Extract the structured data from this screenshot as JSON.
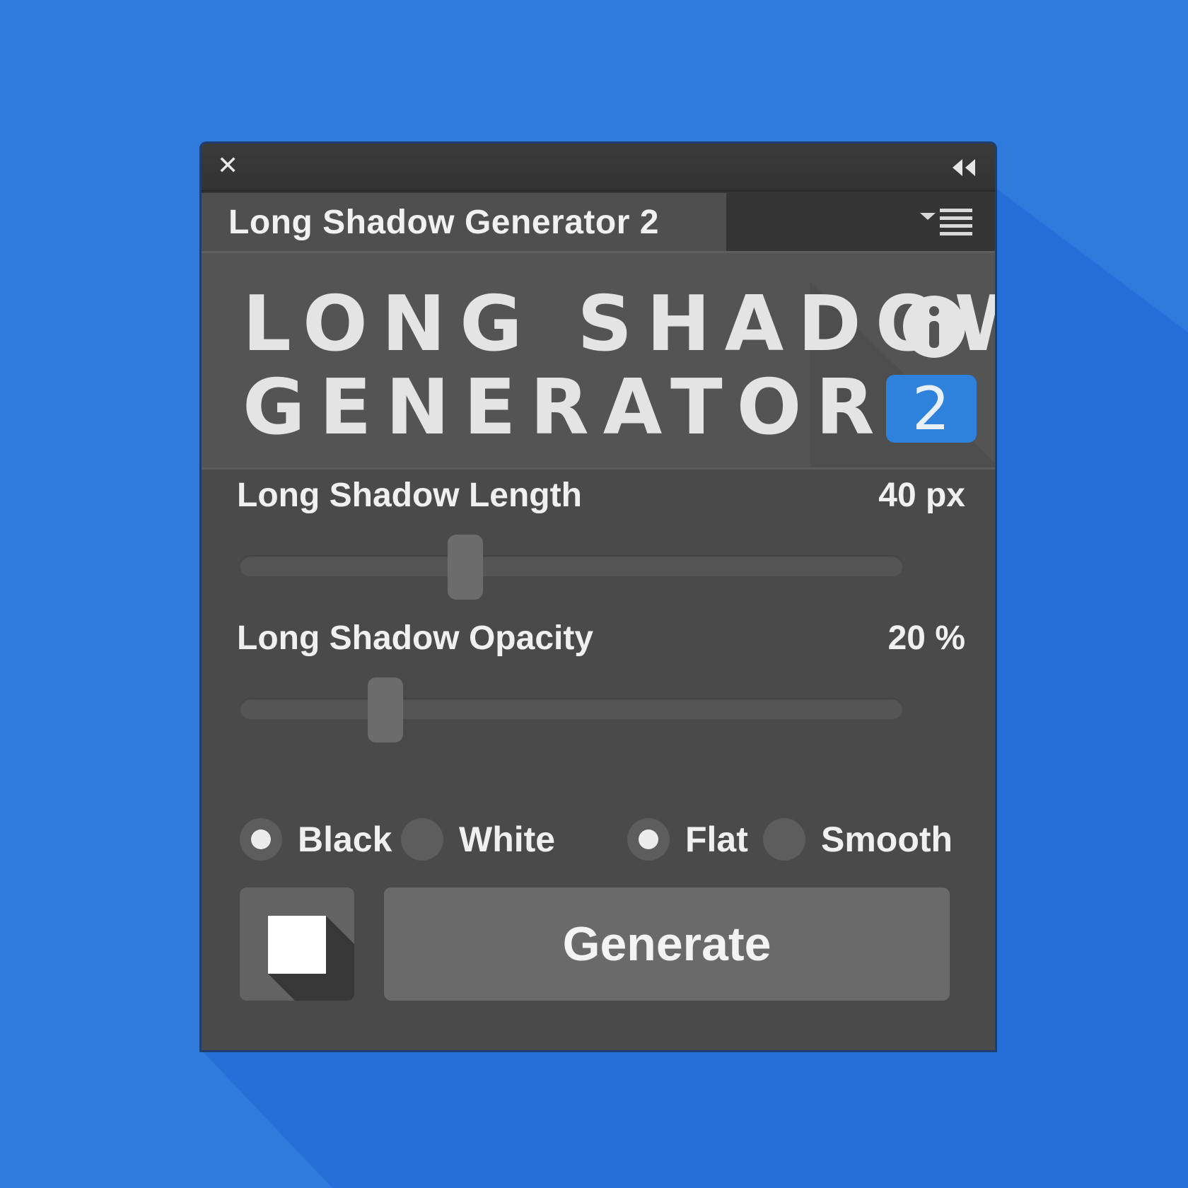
{
  "window": {
    "close_icon": "close-icon",
    "collapse_icon": "double-chevron-left-icon",
    "tab_label": "Long Shadow Generator 2",
    "panel_menu_icon": "panel-menu-icon"
  },
  "header": {
    "logo_line1": "LONG SHADOW",
    "logo_line2": "GENERATOR",
    "version": "2",
    "info_icon": "info-icon",
    "accent_color": "#2f82dc"
  },
  "controls": {
    "length": {
      "label": "Long Shadow Length",
      "value_text": "40 px",
      "slider_fraction": 0.34
    },
    "opacity": {
      "label": "Long Shadow Opacity",
      "value_text": "20 %",
      "slider_fraction": 0.22
    },
    "color_options": [
      {
        "label": "Black",
        "selected": true
      },
      {
        "label": "White",
        "selected": false
      }
    ],
    "style_options": [
      {
        "label": "Flat",
        "selected": true
      },
      {
        "label": "Smooth",
        "selected": false
      }
    ],
    "preview_icon": "shadow-preview-icon",
    "generate_label": "Generate"
  },
  "background_color": "#2f7bdc"
}
